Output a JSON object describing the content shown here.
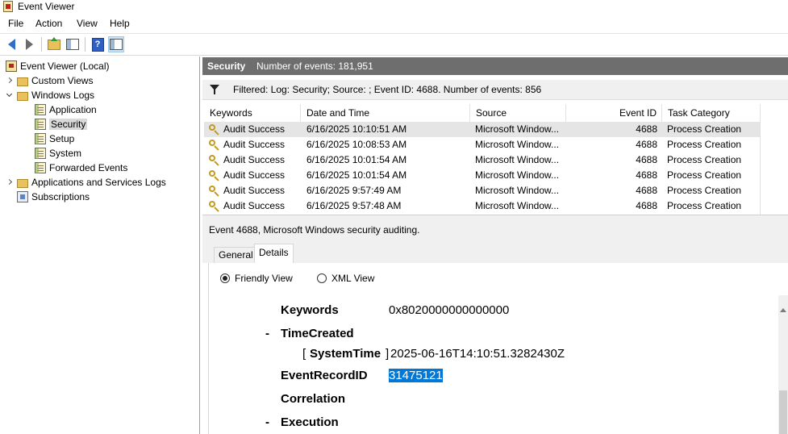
{
  "window": {
    "title": "Event Viewer"
  },
  "menu": [
    "File",
    "Action",
    "View",
    "Help"
  ],
  "tree": {
    "root": "Event Viewer (Local)",
    "custom_views": "Custom Views",
    "windows_logs": "Windows Logs",
    "logs": [
      "Application",
      "Security",
      "Setup",
      "System",
      "Forwarded Events"
    ],
    "app_services": "Applications and Services Logs",
    "subscriptions": "Subscriptions"
  },
  "header": {
    "log_name": "Security",
    "count_text": "Number of events: 181,951"
  },
  "filter": {
    "text": "Filtered: Log: Security; Source: ; Event ID: 4688. Number of events: 856"
  },
  "table": {
    "columns": [
      "Keywords",
      "Date and Time",
      "Source",
      "Event ID",
      "Task Category"
    ],
    "rows": [
      [
        "Audit Success",
        "6/16/2025 10:10:51 AM",
        "Microsoft Window...",
        "4688",
        "Process Creation"
      ],
      [
        "Audit Success",
        "6/16/2025 10:08:53 AM",
        "Microsoft Window...",
        "4688",
        "Process Creation"
      ],
      [
        "Audit Success",
        "6/16/2025 10:01:54 AM",
        "Microsoft Window...",
        "4688",
        "Process Creation"
      ],
      [
        "Audit Success",
        "6/16/2025 10:01:54 AM",
        "Microsoft Window...",
        "4688",
        "Process Creation"
      ],
      [
        "Audit Success",
        "6/16/2025 9:57:49 AM",
        "Microsoft Window...",
        "4688",
        "Process Creation"
      ],
      [
        "Audit Success",
        "6/16/2025 9:57:48 AM",
        "Microsoft Window...",
        "4688",
        "Process Creation"
      ]
    ]
  },
  "detail": {
    "title": "Event 4688, Microsoft Windows security auditing.",
    "tabs": [
      "General",
      "Details"
    ],
    "views": {
      "friendly": "Friendly View",
      "xml": "XML View"
    },
    "fields": {
      "keywords_label": "Keywords",
      "keywords_value": "0x8020000000000000",
      "timecreated_label": "TimeCreated",
      "systemtime_label": "SystemTime",
      "systemtime_value": "2025-06-16T14:10:51.3282430Z",
      "recordid_label": "EventRecordID",
      "recordid_value": "31475121",
      "correlation_label": "Correlation",
      "execution_label": "Execution",
      "dash": "-",
      "lbracket": "[",
      "rbracket": "]"
    }
  }
}
